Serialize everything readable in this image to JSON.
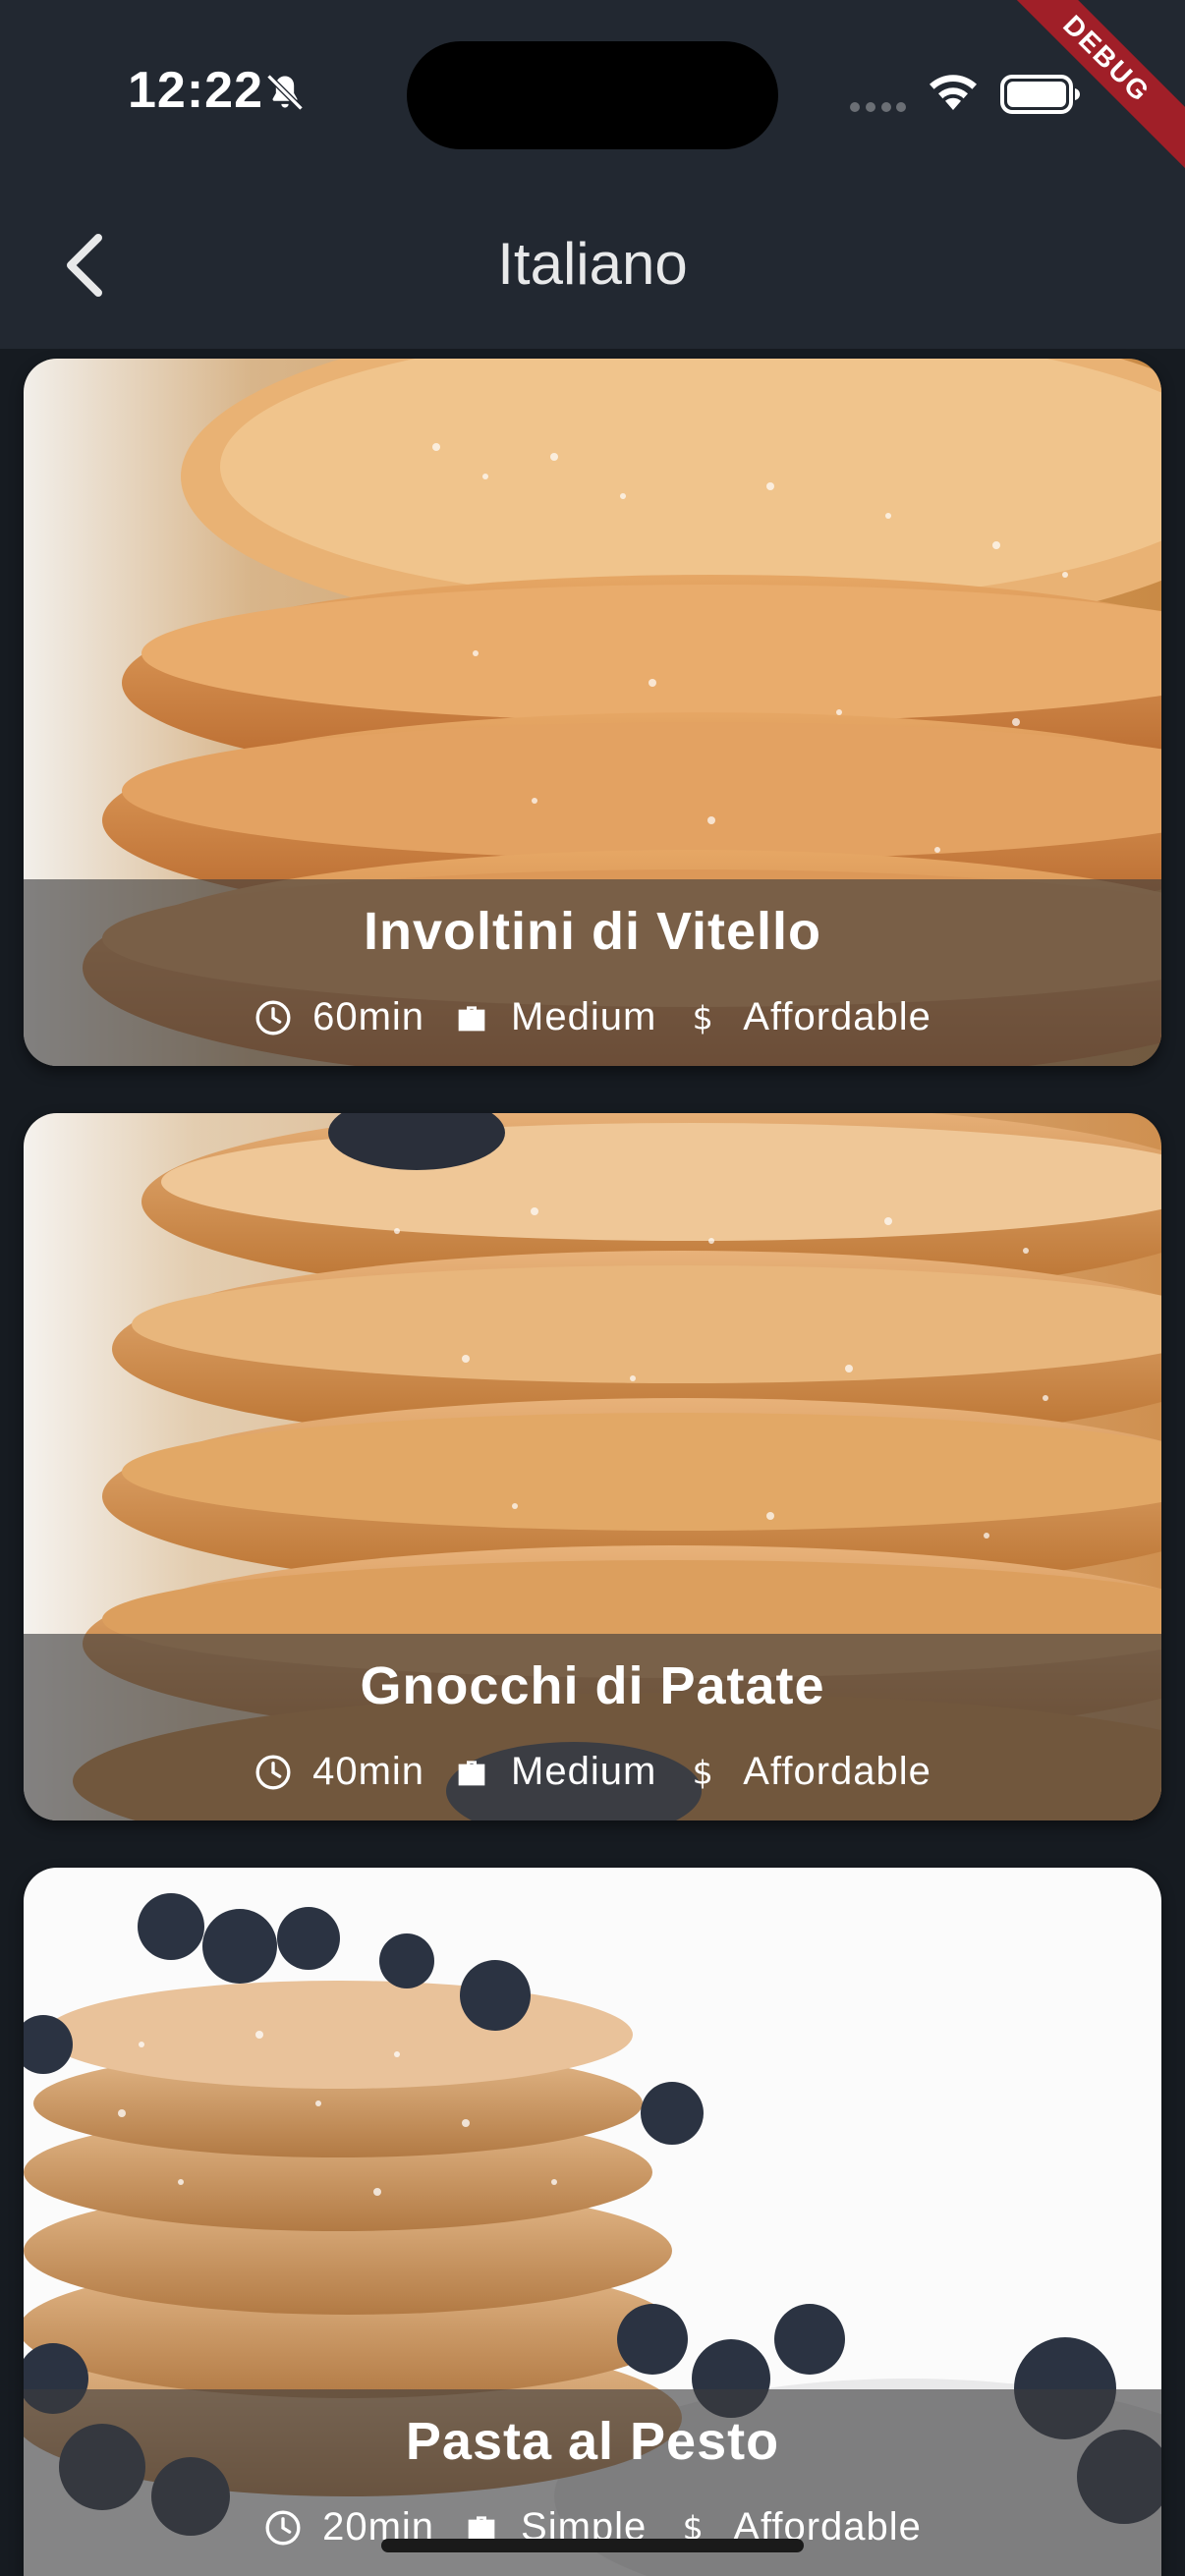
{
  "status_bar": {
    "time": "12:22",
    "debug_label": "DEBUG"
  },
  "app_bar": {
    "title": "Italiano",
    "back_icon": "chevron-left-icon"
  },
  "meals": [
    {
      "title": "Involtini di Vitello",
      "duration": "60min",
      "complexity": "Medium",
      "affordability": "Affordable"
    },
    {
      "title": "Gnocchi di Patate",
      "duration": "40min",
      "complexity": "Medium",
      "affordability": "Affordable"
    },
    {
      "title": "Pasta al Pesto",
      "duration": "20min",
      "complexity": "Simple",
      "affordability": "Affordable"
    }
  ],
  "colors": {
    "app_bar": "#222831",
    "background": "#161b21",
    "overlay": "#3c3c3e",
    "debug": "#a01f28"
  }
}
